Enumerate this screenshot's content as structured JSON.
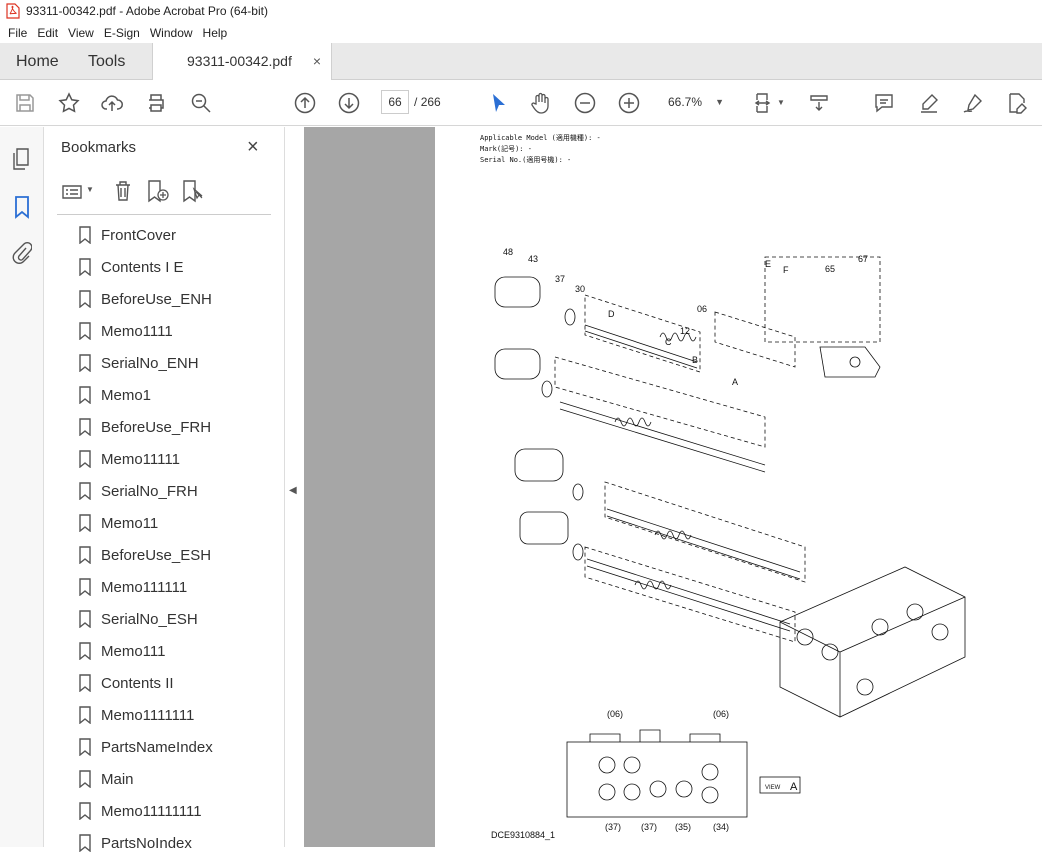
{
  "window": {
    "title": "93311-00342.pdf - Adobe Acrobat Pro (64-bit)"
  },
  "menu": [
    "File",
    "Edit",
    "View",
    "E-Sign",
    "Window",
    "Help"
  ],
  "tabs": {
    "home": "Home",
    "tools": "Tools",
    "document": "93311-00342.pdf",
    "close": "×"
  },
  "toolbar": {
    "current_page": "66",
    "page_separator": "/",
    "total_pages": "266",
    "zoom": "66.7%"
  },
  "bookmarks": {
    "title": "Bookmarks",
    "close": "×",
    "items": [
      "FrontCover",
      "Contents I E",
      "BeforeUse_ENH",
      "Memo1111",
      "SerialNo_ENH",
      "Memo1",
      "BeforeUse_FRH",
      "Memo11111",
      "SerialNo_FRH",
      "Memo11",
      "BeforeUse_ESH",
      "Memo111111",
      "SerialNo_ESH",
      "Memo111",
      "Contents II",
      "Memo1111111",
      "PartsNameIndex",
      "Main",
      "Memo11111111",
      "PartsNoIndex"
    ]
  },
  "page": {
    "applicable_model": "Applicable Model (適用機種): -",
    "mark": "Mark(記号): -",
    "serial_no": "Serial No.(適用号機): -",
    "caption": "DCE9310884_1",
    "view_label": "VIEW",
    "view_letter": "A",
    "callouts_top": [
      "48",
      "43",
      "37",
      "30",
      "06",
      "12",
      "65",
      "67",
      "D",
      "C",
      "B",
      "A",
      "E",
      "F"
    ],
    "callouts_bottom": [
      "(06)",
      "(06)",
      "(37)",
      "(37)",
      "(35)",
      "(34)"
    ]
  },
  "colors": {
    "accent": "#2b6fd4",
    "doc_bg": "#a6a6a6",
    "tab_bg": "#e9e9e9"
  }
}
